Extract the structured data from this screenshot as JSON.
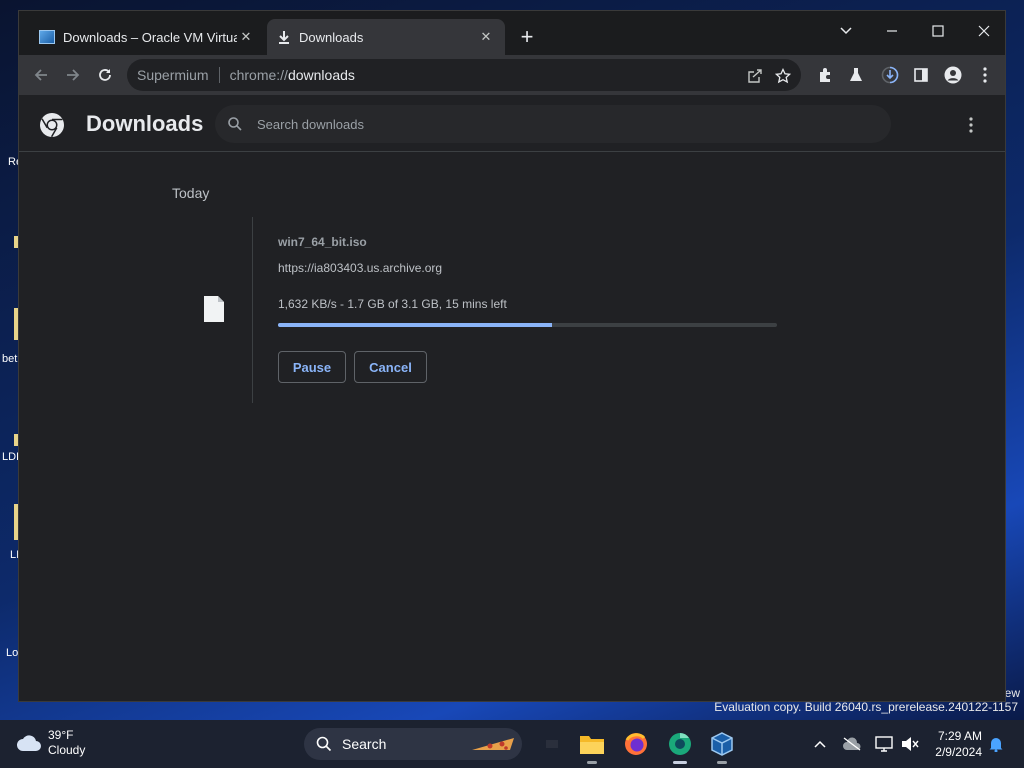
{
  "browser": {
    "tabs": [
      {
        "title": "Downloads – Oracle VM VirtualBox",
        "active": false
      },
      {
        "title": "Downloads",
        "active": true
      }
    ],
    "omnibox": {
      "site": "Supermium",
      "scheme": "chrome://",
      "path": "downloads"
    }
  },
  "downloads_page": {
    "title": "Downloads",
    "search_placeholder": "Search downloads",
    "section_label": "Today",
    "items": [
      {
        "filename": "win7_64_bit.iso",
        "url": "https://ia803403.us.archive.org",
        "status": "1,632 KB/s - 1.7 GB of 3.1 GB, 15 mins left",
        "progress_percent": 55,
        "pause_label": "Pause",
        "cancel_label": "Cancel"
      }
    ]
  },
  "desktop": {
    "icon_labels": [
      "Re",
      "bet",
      "LDI",
      "LI",
      "Lo"
    ],
    "watermark": "Evaluation copy. Build 26040.rs_prerelease.240122-1157",
    "watermark_suffix": "ew"
  },
  "taskbar": {
    "weather_temp": "39°F",
    "weather_desc": "Cloudy",
    "search_label": "Search",
    "time": "7:29 AM",
    "date": "2/9/2024"
  },
  "colors": {
    "accent": "#8ab4f8",
    "page_bg": "#202124",
    "toolbar_bg": "#35363a"
  }
}
